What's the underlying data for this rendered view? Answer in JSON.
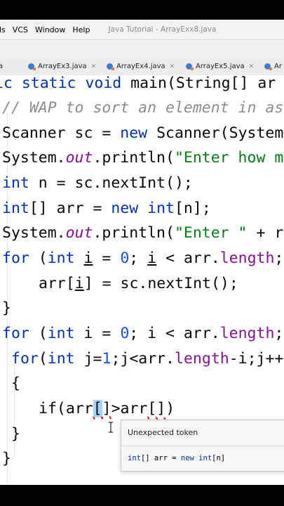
{
  "menu": {
    "items": [
      "ls",
      "VCS",
      "Window",
      "Help"
    ],
    "title": "Java Tutorial - ArrayExx8.java"
  },
  "tabs": [
    {
      "label": "a",
      "icon": "java-class-icon"
    },
    {
      "label": "ArrayEx3.java",
      "icon": "java-class-icon"
    },
    {
      "label": "ArrayEx4.java",
      "icon": "java-class-icon"
    },
    {
      "label": "ArrayEx5.java",
      "icon": "java-class-icon"
    },
    {
      "label": "Ar",
      "icon": "java-class-icon"
    }
  ],
  "code": {
    "l1": {
      "a": "ic static void ",
      "b": "main(String[] ar"
    },
    "l2": "// WAP to sort an element in as",
    "l3": {
      "a": "Scanner sc = ",
      "b": "new",
      "c": " Scanner(System"
    },
    "l4": {
      "a": "System.",
      "b": "out",
      "c": ".println(",
      "d": "\"Enter how m"
    },
    "l5": {
      "a": "int",
      "b": " n = sc.nextInt();"
    },
    "l6": {
      "a": "int",
      "b": "[] arr = ",
      "c": "new",
      "d": " ",
      "e": "int",
      "f": "[n];"
    },
    "l7": {
      "a": "System.",
      "b": "out",
      "c": ".println(",
      "d": "\"Enter \"",
      "e": " + r"
    },
    "l8": {
      "a": "for",
      "b": " (",
      "c": "int",
      "d": " ",
      "e": "i",
      "f": " = ",
      "g": "0",
      "h": "; ",
      "i": "i",
      "j": " < arr.",
      "k": "length",
      "l": ";"
    },
    "l9": {
      "a": "arr[",
      "b": "i",
      "c": "] = sc.nextInt();"
    },
    "l10": "}",
    "l11": {
      "a": "for",
      "b": " (",
      "c": "int",
      "d": " i = ",
      "e": "0",
      "f": "; i < arr.",
      "g": "length",
      "h": ";"
    },
    "l12": {
      "a": "for",
      "b": "(",
      "c": "int",
      "d": " j=",
      "e": "1",
      "f": ";j<arr.",
      "g": "length",
      "h": "-i;j++"
    },
    "l13": "{",
    "l14": {
      "a": "if(arr",
      "b": "[",
      "c": "]",
      "d": ">arr",
      "e": "[]",
      "f": ")"
    },
    "l15": "}",
    "l16": "}"
  },
  "popup": {
    "header": "Unexpected token",
    "sig_a": "int",
    "sig_b": "[] arr = ",
    "sig_c": "new",
    "sig_d": " ",
    "sig_e": "int",
    "sig_f": "[n]"
  }
}
